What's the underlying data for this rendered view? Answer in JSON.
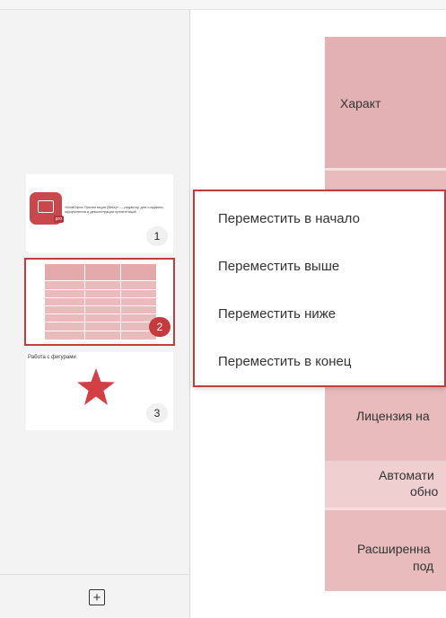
{
  "sidebar": {
    "slides": [
      {
        "number": "1",
        "app_icon_badge": "pro",
        "description": "«МойОфис Презентация (Beta)» — редактор для создания, оформления и демонстрации презентаций"
      },
      {
        "number": "2",
        "selected": true
      },
      {
        "number": "3",
        "title": "Работа с фигурами"
      }
    ],
    "add_slide_icon": "+"
  },
  "main_table": {
    "header_text": "Характ",
    "rows": [
      {
        "line1": "Лицензия на"
      },
      {
        "line1": "Автомати",
        "line2": "обно"
      },
      {
        "line1": "Расширенна",
        "line2": "под"
      }
    ]
  },
  "context_menu": {
    "items": [
      "Переместить в начало",
      "Переместить выше",
      "Переместить ниже",
      "Переместить в конец"
    ]
  },
  "colors": {
    "accent": "#c33a3f",
    "table_fill": "#e8bcbd",
    "table_light": "#f0cfd0"
  }
}
